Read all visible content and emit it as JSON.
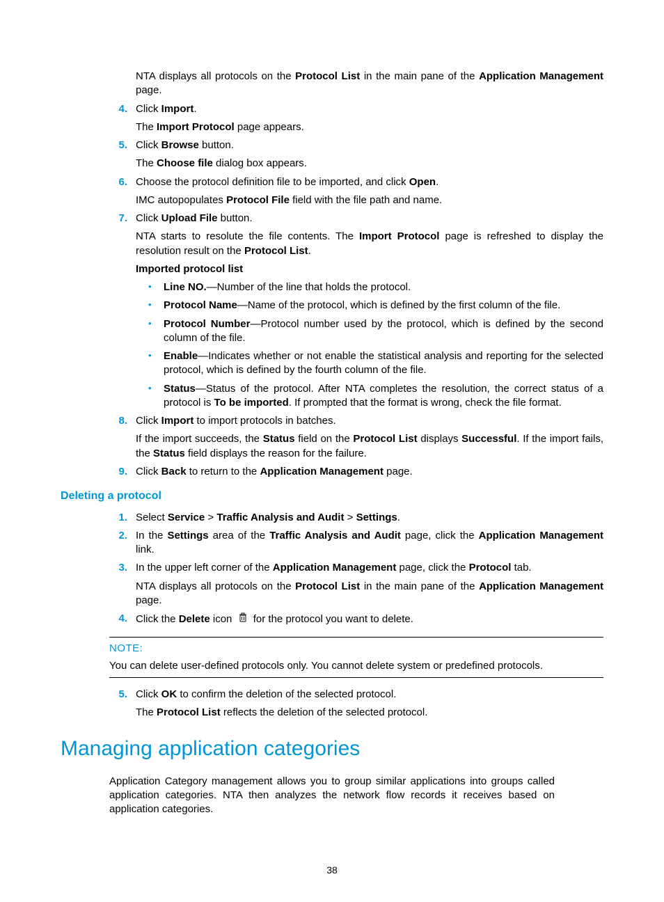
{
  "intro": {
    "p1_a": "NTA displays all protocols on the ",
    "p1_b": "Protocol List",
    "p1_c": " in the main pane of the ",
    "p1_d": "Application Management",
    "p1_e": " page."
  },
  "steps1": {
    "s4": {
      "num": "4.",
      "a": "Click ",
      "b": "Import",
      "c": ".",
      "p2a": "The ",
      "p2b": "Import Protocol",
      "p2c": " page appears."
    },
    "s5": {
      "num": "5.",
      "a": "Click ",
      "b": "Browse",
      "c": " button.",
      "p2a": "The ",
      "p2b": "Choose file",
      "p2c": " dialog box appears."
    },
    "s6": {
      "num": "6.",
      "a": "Choose the protocol definition file to be imported, and click ",
      "b": "Open",
      "c": ".",
      "p2a": "IMC autopopulates ",
      "p2b": "Protocol File",
      "p2c": " field with the file path and name."
    },
    "s7": {
      "num": "7.",
      "a": "Click ",
      "b": "Upload File",
      "c": " button.",
      "p2a": "NTA starts to resolute the file contents. The ",
      "p2b": "Import Protocol",
      "p2c": " page is refreshed to display the resolution result on the ",
      "p2d": "Protocol List",
      "p2e": ".",
      "subhead": "Imported protocol list",
      "bullets": {
        "b1a": "Line NO.",
        "b1b": "—Number of the line that holds the protocol.",
        "b2a": "Protocol Name",
        "b2b": "—Name of the protocol, which is defined by the first column of the file.",
        "b3a": "Protocol Number",
        "b3b": "—Protocol number used by the protocol, which is defined by the second column of the file.",
        "b4a": "Enable",
        "b4b": "—Indicates whether or not enable the statistical analysis and reporting for the selected protocol, which is defined by the fourth column of the file.",
        "b5a": "Status",
        "b5b": "—Status of the protocol. After NTA completes the resolution, the correct status of a protocol is ",
        "b5c": "To be imported",
        "b5d": ". If prompted that the format is wrong, check the file format."
      }
    },
    "s8": {
      "num": "8.",
      "a": "Click ",
      "b": "Import",
      "c": " to import protocols in batches.",
      "p2a": "If the import succeeds, the ",
      "p2b": "Status",
      "p2c": " field on the ",
      "p2d": "Protocol List",
      "p2e": " displays ",
      "p2f": "Successful",
      "p2g": ". If the import fails, the ",
      "p2h": "Status",
      "p2i": " field displays the reason for the failure."
    },
    "s9": {
      "num": "9.",
      "a": "Click ",
      "b": "Back",
      "c": " to return to the ",
      "d": "Application Management",
      "e": " page."
    }
  },
  "heading_delete": "Deleting a protocol",
  "steps2": {
    "s1": {
      "num": "1.",
      "a": "Select ",
      "b": "Service",
      "c": " > ",
      "d": "Traffic Analysis and Audit",
      "e": " > ",
      "f": "Settings",
      "g": "."
    },
    "s2": {
      "num": "2.",
      "a": "In the ",
      "b": "Settings",
      "c": " area of the ",
      "d": "Traffic Analysis and Audit",
      "e": " page, click the ",
      "f": "Application Management",
      "g": " link."
    },
    "s3": {
      "num": "3.",
      "a": "In the upper left corner of the ",
      "b": "Application Management",
      "c": " page, click the ",
      "d": "Protocol",
      "e": " tab.",
      "p2a": "NTA displays all protocols on the ",
      "p2b": "Protocol List",
      "p2c": " in the main pane of the ",
      "p2d": "Application Management",
      "p2e": " page."
    },
    "s4": {
      "num": "4.",
      "a": "Click the ",
      "b": "Delete",
      "c": " icon ",
      "d": " for the protocol you want to delete."
    }
  },
  "note": {
    "label": "NOTE:",
    "body": "You can delete user-defined protocols only. You cannot delete system or predefined protocols."
  },
  "steps3": {
    "s5": {
      "num": "5.",
      "a": "Click ",
      "b": "OK",
      "c": " to confirm the deletion of the selected protocol.",
      "p2a": "The ",
      "p2b": "Protocol List",
      "p2c": " reflects the deletion of the selected protocol."
    }
  },
  "heading_main": "Managing application categories",
  "main_para": "Application Category management allows you to group similar applications into groups called application categories. NTA then analyzes the network flow records it receives based on application categories.",
  "page_number": "38"
}
